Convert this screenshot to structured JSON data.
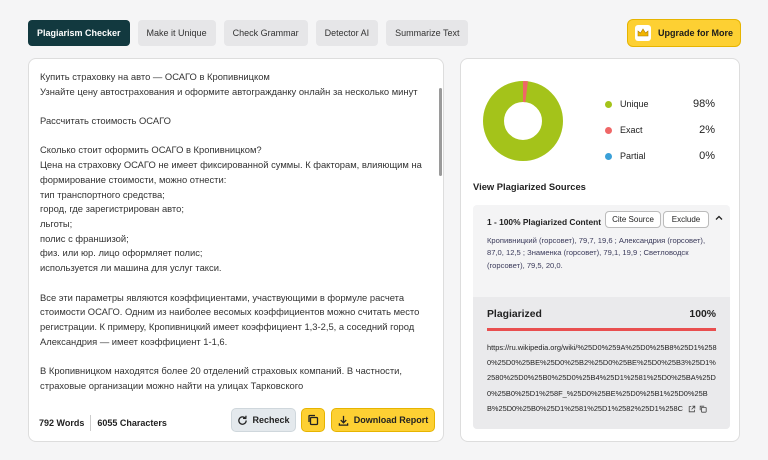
{
  "tabs": [
    "Plagiarism Checker",
    "Make it Unique",
    "Check Grammar",
    "Detector AI",
    "Summarize Text"
  ],
  "upgrade_label": "Upgrade for More",
  "editor": {
    "paragraphs": [
      "Купить страховку на авто — ОСАГО в Кропивницком\nУзнайте цену автострахования и оформите автогражданку онлайн за несколько минут",
      "Рассчитать стоимость ОСАГО",
      "Сколько стоит оформить ОСАГО в Кропивницком?\nЦена на страховку ОСАГО не имеет фиксированной суммы. К факторам, влияющим на формирование стоимости, можно отнести:\nтип транспортного средства;\nгород, где зарегистрирован авто;\nльготы;\nполис с франшизой;\nфиз. или юр. лицо оформляет полис;\nиспользуется ли машина для услуг такси.",
      "Все эти параметры являются коэффициентами, участвующими в формуле расчета стоимости ОСАГО. Одним из наиболее весомых коэффициентов можно считать место регистрации. К примеру, Кропивницкий имеет коэффициент 1,3-2,5, а соседний город Александрия — имеет коэффициент 1-1,6.",
      "В Кропивницком находятся более 20 отделений страховых компаний. В частности, страховые организации можно найти на улицах Тарковского"
    ],
    "words": "792 Words",
    "characters": "6055 Characters",
    "recheck_label": "Recheck",
    "download_label": "Download Report"
  },
  "results": {
    "legend": [
      {
        "label": "Unique",
        "value": "98%",
        "color": "#a4c31a"
      },
      {
        "label": "Exact",
        "value": "2%",
        "color": "#ef6767"
      },
      {
        "label": "Partial",
        "value": "0%",
        "color": "#3aa0d8"
      }
    ],
    "donut": {
      "unique": 98,
      "exact": 2,
      "partial": 0
    },
    "sources_title": "View Plagiarized Sources",
    "source": {
      "heading": "1 - 100% Plagiarized Content",
      "cite_label": "Cite Source",
      "exclude_label": "Exclude",
      "snippet": "Кропивницкий (горсовет), 79,7, 19,6 ; Александрия (горсовет), 87,0, 12,5 ; Знаменка (горсовет), 79,1, 19,9 ; Светловодск (горсовет), 79,5, 20,0.",
      "plag_label": "Plagiarized",
      "plag_pct": "100%",
      "url": "https://ru.wikipedia.org/wiki/%25D0%259A%25D0%25B8%25D1%2580%25D0%25BE%25D0%25B2%25D0%25BE%25D0%25B3%25D1%2580%25D0%25B0%25D0%25B4%25D1%2581%25D0%25BA%25D0%25B0%25D1%258F_%25D0%25BE%25D0%25B1%25D0%25BB%25D0%25B0%25D1%2581%25D1%2582%25D1%258C"
    }
  }
}
